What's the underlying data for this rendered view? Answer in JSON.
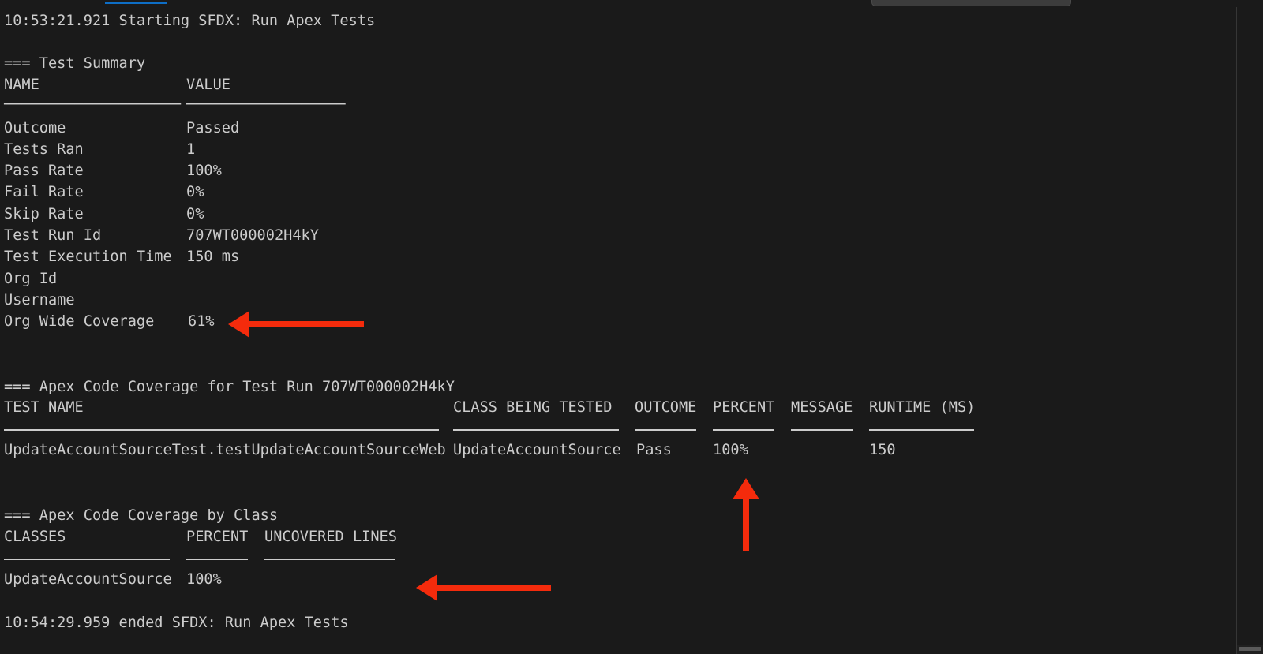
{
  "terminal": {
    "background_color": "#1a1a1a",
    "text_color": "#cccccc",
    "accent_color": "#0e6ec6",
    "annotation_color": "#f42b0c",
    "start_line": "10:53:21.921 Starting SFDX: Run Apex Tests",
    "end_line": "10:54:29.959 ended SFDX: Run Apex Tests",
    "test_summary": {
      "heading": "=== Test Summary",
      "columns": [
        "NAME",
        "VALUE"
      ],
      "rule_name": "────────────────────",
      "rule_value": "──────────────────",
      "rows": [
        {
          "name": "Outcome",
          "value": "Passed"
        },
        {
          "name": "Tests Ran",
          "value": "1"
        },
        {
          "name": "Pass Rate",
          "value": "100%"
        },
        {
          "name": "Fail Rate",
          "value": "0%"
        },
        {
          "name": "Skip Rate",
          "value": "0%"
        },
        {
          "name": "Test Run Id",
          "value": "707WT000002H4kY"
        },
        {
          "name": "Test Execution Time",
          "value": "150 ms"
        },
        {
          "name": "Org Id",
          "value": ""
        },
        {
          "name": "Username",
          "value": ""
        },
        {
          "name": "Org Wide Coverage",
          "value": "61%"
        }
      ]
    },
    "coverage_for_run": {
      "heading": "=== Apex Code Coverage for Test Run 707WT000002H4kY",
      "header_line": "TEST NAME                                             CLASS BEING TESTED  OUTCOME  PERCENT  MESSAGE  RUNTIME (MS)",
      "rule_line": "─────────────────────────────────────────────────────  ──────────────────  ───────  ───────  ───────  ────────────",
      "row_line": "UpdateAccountSourceTest.testUpdateAccountSourceWeb     UpdateAccountSource  Pass     100%              150",
      "columns": [
        "TEST NAME",
        "CLASS BEING TESTED",
        "OUTCOME",
        "PERCENT",
        "MESSAGE",
        "RUNTIME (MS)"
      ],
      "rows": [
        {
          "test_name": "UpdateAccountSourceTest.testUpdateAccountSourceWeb",
          "class_being_tested": "UpdateAccountSource",
          "outcome": "Pass",
          "percent": "100%",
          "message": "",
          "runtime_ms": "150"
        }
      ]
    },
    "coverage_by_class": {
      "heading": "=== Apex Code Coverage by Class",
      "header_line": "CLASSES              PERCENT  UNCOVERED LINES",
      "rule_line": "───────────────────  ───────  ───────────────",
      "row_line": "UpdateAccountSource  100%",
      "columns": [
        "CLASSES",
        "PERCENT",
        "UNCOVERED LINES"
      ],
      "rows": [
        {
          "classes": "UpdateAccountSource",
          "percent": "100%",
          "uncovered_lines": ""
        }
      ]
    }
  },
  "annotations": [
    {
      "name": "org-wide-coverage-arrow",
      "direction": "left",
      "target": "61%"
    },
    {
      "name": "percent-column-arrow",
      "direction": "up",
      "target": "100%"
    },
    {
      "name": "class-coverage-arrow",
      "direction": "left",
      "target": "100%"
    }
  ]
}
